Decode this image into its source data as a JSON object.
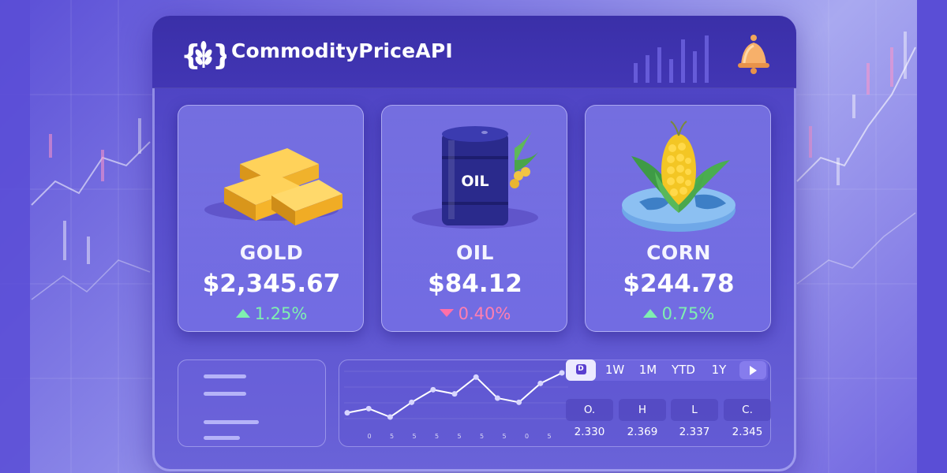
{
  "app": {
    "title": "CommodityPriceAPI"
  },
  "icons": {
    "logo": "wheat-braces-logo-icon",
    "notifications": "bell-icon",
    "play": "play-icon",
    "day": "day-square-icon"
  },
  "colors": {
    "accent": "#5a3fd0",
    "up": "#7ff0b0",
    "down": "#ff6fa8",
    "gold": "#f5b42a",
    "background": "#5b4fd6"
  },
  "cards": [
    {
      "name": "GOLD",
      "price": "$2,345.67",
      "change": "1.25%",
      "direction": "up",
      "art": "gold-bars-icon"
    },
    {
      "name": "OIL",
      "price": "$84.12",
      "change": "0.40%",
      "direction": "down",
      "art": "oil-barrel-icon",
      "art_label": "OIL"
    },
    {
      "name": "CORN",
      "price": "$244.78",
      "change": "0.75%",
      "direction": "up",
      "art": "corn-globe-icon"
    }
  ],
  "ranges": {
    "active": "D",
    "items": [
      "1W",
      "1M",
      "YTD",
      "1Y"
    ]
  },
  "ohlc": {
    "open": "O. 2.330",
    "high": "H 2.369",
    "low": "L 2.337",
    "close": "C. 2.345"
  },
  "mini_chart": {
    "values": [
      2.331,
      2.333,
      2.329,
      2.336,
      2.342,
      2.34,
      2.348,
      2.338,
      2.336,
      2.345,
      2.35
    ],
    "x_ticks": [
      "0",
      "5",
      "5",
      "5",
      "5",
      "5",
      "5",
      "0",
      "5"
    ]
  }
}
